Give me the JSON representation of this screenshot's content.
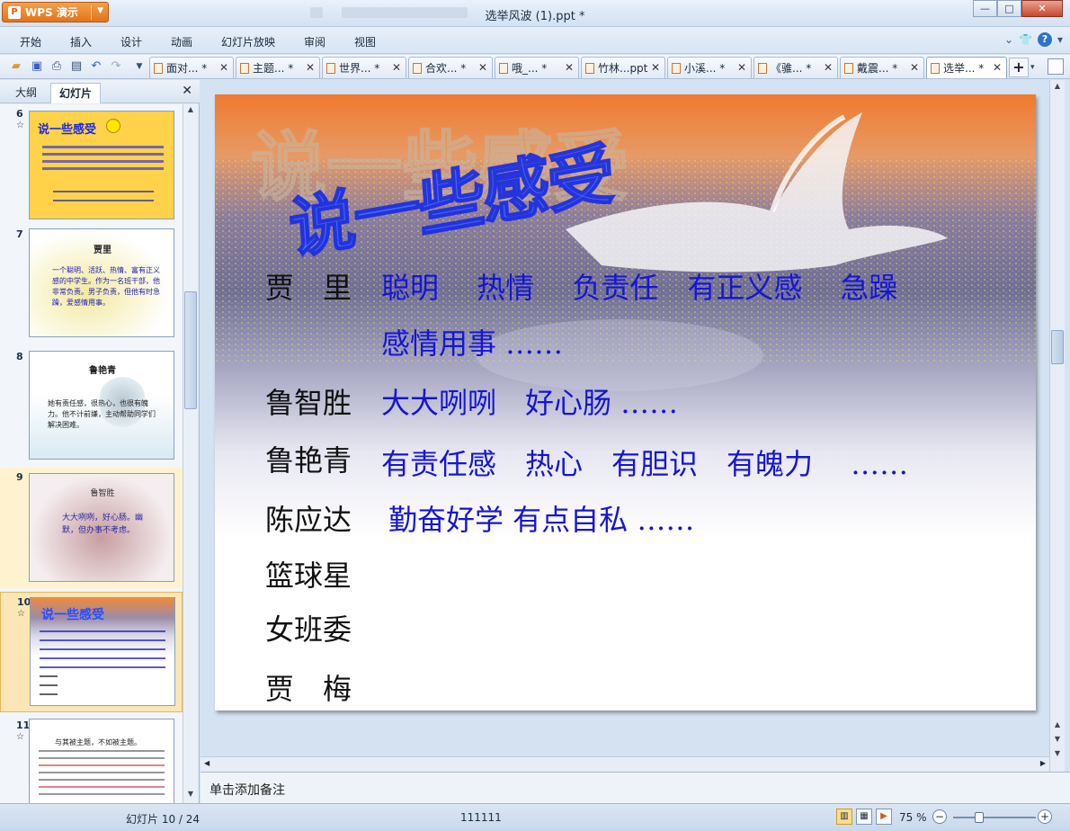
{
  "app": {
    "button_label": "WPS 演示",
    "window_title": "选举风波 (1).ppt *"
  },
  "menu": [
    "开始",
    "插入",
    "设计",
    "动画",
    "幻灯片放映",
    "审阅",
    "视图"
  ],
  "doc_tabs": [
    {
      "label": "面对... *"
    },
    {
      "label": "主题... *"
    },
    {
      "label": "世界... *"
    },
    {
      "label": "合欢... *"
    },
    {
      "label": "哦_... *"
    },
    {
      "label": "竹林...ppt"
    },
    {
      "label": "小溪... *"
    },
    {
      "label": "《骓... *"
    },
    {
      "label": "戴震... *"
    },
    {
      "label": "选举... *"
    }
  ],
  "left_panel": {
    "tabs": [
      "大纲",
      "幻灯片"
    ],
    "thumbnails": [
      {
        "number": "6",
        "star": "☆",
        "title": "说一些感受"
      },
      {
        "number": "7",
        "star": "",
        "title": "贾里",
        "body": "一个聪明、活跃、热情、富有正义感的中学生。作为一名班干部，他非常负责。男子负责，但他有时急躁，爱感情用事。"
      },
      {
        "number": "8",
        "star": "",
        "title": "鲁艳青",
        "body": "她有责任感，很热心，也很有魄力。他不计前嫌，主动帮助同学们解决困难。"
      },
      {
        "number": "9",
        "star": "",
        "title": "鲁智胜",
        "body": "大大咧咧，好心肠。幽默，但办事不考虑。"
      },
      {
        "number": "10",
        "star": "☆",
        "title": "说一些感受"
      },
      {
        "number": "11",
        "star": "☆",
        "title": "与其被主题，不如被主题。"
      }
    ]
  },
  "slide": {
    "title": "说一些感受",
    "rows": [
      {
        "name": "贾　里",
        "traits": "聪明　 热情　 负责任　有正义感　 急躁"
      },
      {
        "name": "",
        "traits": "感情用事 ……"
      },
      {
        "name": "鲁智胜",
        "traits": "大大咧咧　好心肠 ……"
      },
      {
        "name": "鲁艳青",
        "traits": "有责任感　热心　有胆识　有魄力　 ……"
      },
      {
        "name": "陈应达",
        "traits": "勤奋好学 有点自私 ……"
      },
      {
        "name": "篮球星",
        "traits": ""
      },
      {
        "name": "女班委",
        "traits": ""
      },
      {
        "name": "贾　梅",
        "traits": ""
      }
    ]
  },
  "notes_placeholder": "单击添加备注",
  "status": {
    "slide_counter": "幻灯片 10 / 24",
    "theme_name": "111111",
    "zoom": "75 %"
  }
}
